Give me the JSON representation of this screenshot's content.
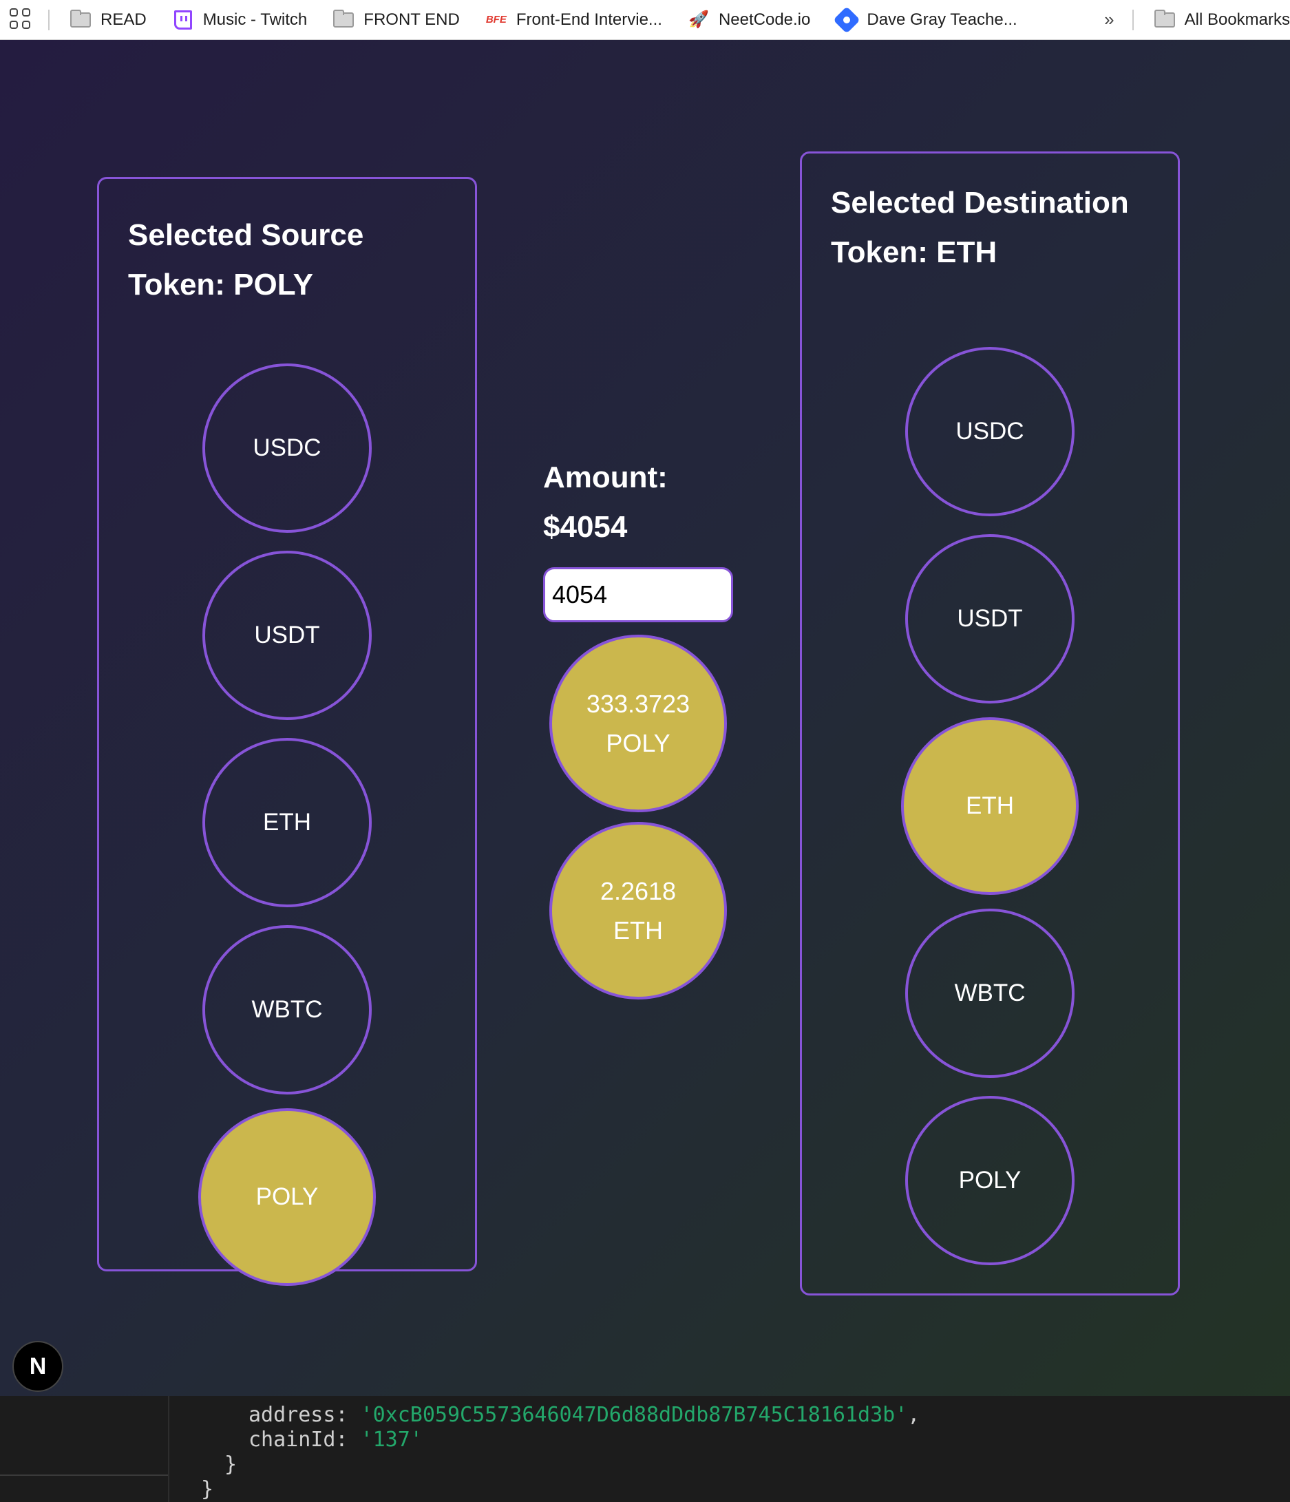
{
  "bookmarks": {
    "items": [
      {
        "label": "READ",
        "icon": "folder-icon"
      },
      {
        "label": "Music - Twitch",
        "icon": "twitch-icon"
      },
      {
        "label": "FRONT END",
        "icon": "folder-icon"
      },
      {
        "label": "Front-End Intervie...",
        "icon": "bfe-icon",
        "icon_text": "BFE"
      },
      {
        "label": "NeetCode.io",
        "icon": "rocket-icon"
      },
      {
        "label": "Dave Gray Teache...",
        "icon": "diamond-icon"
      }
    ],
    "more": "»",
    "all_bookmarks": "All Bookmarks"
  },
  "source": {
    "title": "Selected Source Token: POLY",
    "tokens": [
      "USDC",
      "USDT",
      "ETH",
      "WBTC",
      "POLY"
    ],
    "selected": "POLY"
  },
  "destination": {
    "title": "Selected Destination Token: ETH",
    "tokens": [
      "USDC",
      "USDT",
      "ETH",
      "WBTC",
      "POLY"
    ],
    "selected": "ETH"
  },
  "amount": {
    "title": "Amount: $4054",
    "input_value": "4054",
    "source_result": {
      "value": "333.3723",
      "symbol": "POLY"
    },
    "dest_result": {
      "value": "2.2618",
      "symbol": "ETH"
    }
  },
  "next_badge": "N",
  "terminal": {
    "line1_key": "address: ",
    "line1_val": "'0xcB059C5573646047D6d88dDdb87B745C18161d3b'",
    "line1_end": ",",
    "line2_key": "chainId: ",
    "line2_val": "'137'",
    "line3": "}",
    "line4": "}"
  },
  "colors": {
    "accent": "#8754d8",
    "selected": "#cbb74d",
    "string": "#23a86b"
  }
}
